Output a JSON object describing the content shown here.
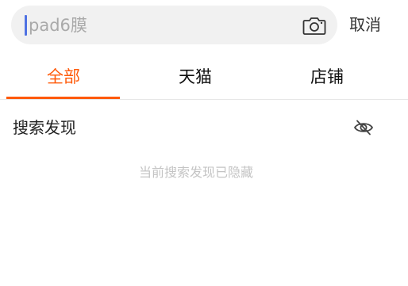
{
  "search": {
    "placeholder": "pad6膜",
    "camera_icon": "camera-icon",
    "cancel_label": "取消"
  },
  "tabs": [
    {
      "label": "全部",
      "active": true
    },
    {
      "label": "天猫",
      "active": false
    },
    {
      "label": "店铺",
      "active": false
    }
  ],
  "discover": {
    "title": "搜索发现",
    "toggle_icon": "eye-off-icon",
    "hidden_message": "当前搜索发现已隐藏"
  },
  "colors": {
    "accent": "#ff5a0a",
    "caret": "#4f72e3",
    "search_bg": "#f1f1f1",
    "muted_text": "#c4c4c4"
  }
}
